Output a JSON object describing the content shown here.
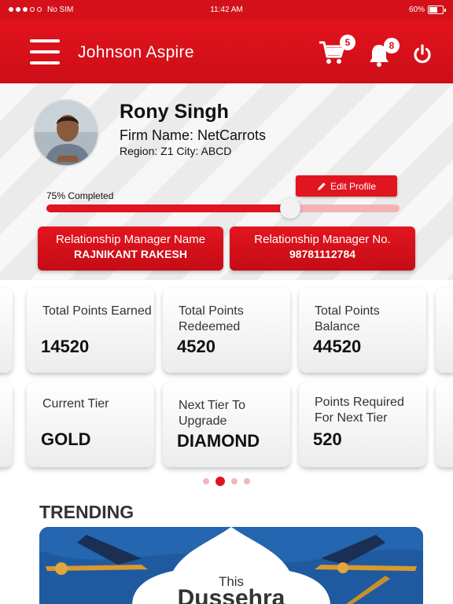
{
  "status_bar": {
    "carrier": "No SIM",
    "time": "11:42 AM",
    "battery": "60%"
  },
  "header": {
    "title": "Johnson Aspire",
    "cart_count": "5",
    "notification_count": "8"
  },
  "profile": {
    "name": "Rony Singh",
    "firm": "Firm Name: NetCarrots",
    "region": "Region: Z1  City: ABCD",
    "edit_label": "Edit Profile",
    "progress_label": "75% Completed",
    "progress_fraction": 0.69
  },
  "relationship_manager": {
    "name_label": "Relationship Manager Name",
    "name_value": "RAJNIKANT RAKESH",
    "number_label": "Relationship Manager No.",
    "number_value": "98781112784"
  },
  "stats": [
    {
      "label": "Total Points Earned",
      "value": "14520"
    },
    {
      "label": "Total Points Redeemed",
      "value": "4520"
    },
    {
      "label": "Total Points Balance",
      "value": "44520"
    },
    {
      "label": "Current Tier",
      "value": "GOLD"
    },
    {
      "label": "Next Tier To Upgrade",
      "value": "DIAMOND"
    },
    {
      "label": "Points Required For Next Tier",
      "value": "520"
    }
  ],
  "trending": {
    "heading": "TRENDING",
    "banner_small": "This",
    "banner_big": "Dussehra"
  },
  "colors": {
    "brand_red": "#e01520",
    "banner_blue": "#1f5aa0"
  }
}
